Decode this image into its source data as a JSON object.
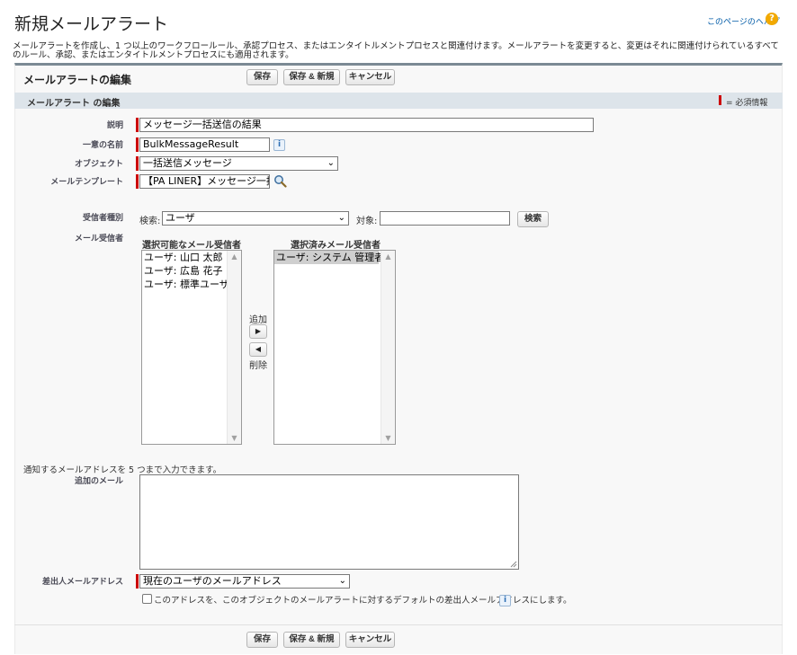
{
  "page": {
    "title": "新規メールアラート",
    "help_link": "このページのヘルプ",
    "help_icon": "question-icon",
    "description": "メールアラートを作成し、1 つ以上のワークフロールール、承認プロセス、またはエンタイトルメントプロセスと関連付けます。メールアラートを変更すると、変更はそれに関連付けられているすべてのルール、承認、またはエンタイトルメントプロセスにも適用されます。"
  },
  "panel": {
    "title": "メールアラートの編集",
    "buttons": {
      "save": "保存",
      "save_new": "保存 & 新規",
      "cancel": "キャンセル"
    }
  },
  "section": {
    "title": "メールアラート の編集",
    "required_legend": "= 必須情報"
  },
  "fields": {
    "description": {
      "label": "説明",
      "value": "メッセージ一括送信の結果"
    },
    "unique_name": {
      "label": "一意の名前",
      "value": "BulkMessageResult"
    },
    "object": {
      "label": "オブジェクト",
      "value": "一括送信メッセージ"
    },
    "template": {
      "label": "メールテンプレート",
      "value": "【PA LINER】メッセージ一括送"
    },
    "recipient_type": {
      "label": "受信者種別",
      "search_label": "検索:",
      "search_value": "ユーザ",
      "target_label": "対象:",
      "target_value": "",
      "search_button": "検索"
    },
    "recipients": {
      "label": "メール受信者",
      "available_title": "選択可能なメール受信者",
      "available": [
        "ユーザ: 山口 太郎",
        "ユーザ: 広島 花子",
        "ユーザ: 標準ユーザ"
      ],
      "selected_title": "選択済みメール受信者",
      "selected": [
        "ユーザ: システム 管理者"
      ],
      "add_label": "追加",
      "remove_label": "削除"
    },
    "additional": {
      "hint": "通知するメールアドレスを 5 つまで入力できます。",
      "label": "追加のメール",
      "value": ""
    },
    "from_address": {
      "label": "差出人メールアドレス",
      "value": "現在のユーザのメールアドレス",
      "default_checkbox_label": "このアドレスを、このオブジェクトのメールアラートに対するデフォルトの差出人メールアドレスにします。"
    }
  },
  "colors": {
    "required": "#cc0000",
    "section_bar": "#dde4ea",
    "panel_top_border": "#7b8a94",
    "help_icon": "#f2a900",
    "link": "#015ba7"
  }
}
